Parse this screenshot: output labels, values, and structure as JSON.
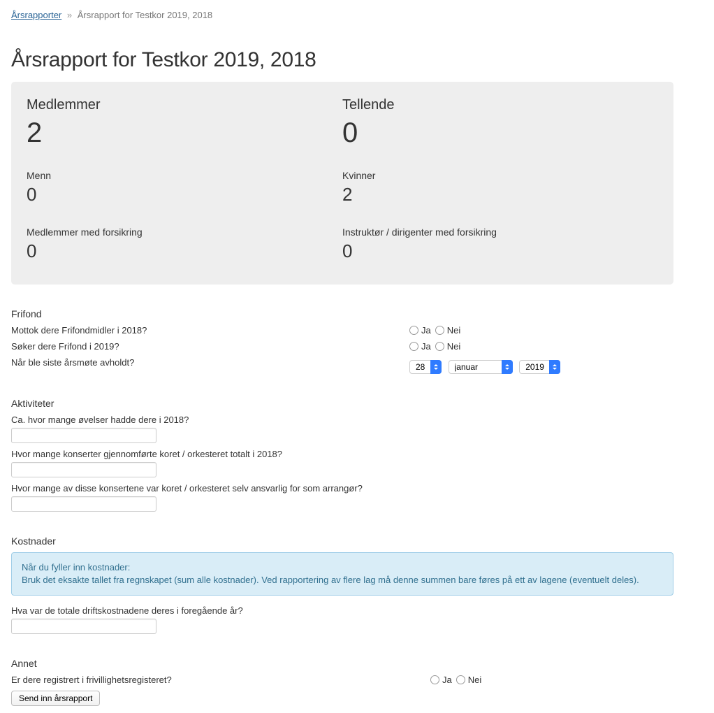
{
  "breadcrumb": {
    "root": "Årsrapporter",
    "sep": "»",
    "current": "Årsrapport for Testkor 2019, 2018"
  },
  "title": "Årsrapport for Testkor 2019, 2018",
  "stats": {
    "members_label": "Medlemmer",
    "members_value": "2",
    "counting_label": "Tellende",
    "counting_value": "0",
    "men_label": "Menn",
    "men_value": "0",
    "women_label": "Kvinner",
    "women_value": "2",
    "insured_members_label": "Medlemmer med forsikring",
    "insured_members_value": "0",
    "insured_instructors_label": "Instruktør / dirigenter med forsikring",
    "insured_instructors_value": "0"
  },
  "frifond": {
    "heading": "Frifond",
    "q_received": "Mottok dere Frifondmidler i 2018?",
    "q_apply": "Søker dere Frifond i 2019?",
    "q_meeting": "Når ble siste årsmøte avholdt?",
    "yes": "Ja",
    "no": "Nei",
    "day": "28",
    "month": "januar",
    "year": "2019"
  },
  "activities": {
    "heading": "Aktiviteter",
    "q_rehearsals": "Ca. hvor mange øvelser hadde dere i 2018?",
    "q_concerts_total": "Hvor mange konserter gjennomførte koret / orkesteret totalt i 2018?",
    "q_concerts_own": "Hvor mange av disse konsertene var koret / orkesteret selv ansvarlig for som arrangør?"
  },
  "costs": {
    "heading": "Kostnader",
    "info_line1": "Når du fyller inn kostnader:",
    "info_line2": "Bruk det eksakte tallet fra regnskapet (sum alle kostnader). Ved rapportering av flere lag må denne summen bare føres på ett av lagene (eventuelt deles).",
    "q_total": "Hva var de totale driftskostnadene deres i foregående år?"
  },
  "other": {
    "heading": "Annet",
    "q_register": "Er dere registrert i frivillighetsregisteret?",
    "yes": "Ja",
    "no": "Nei"
  },
  "submit_label": "Send inn årsrapport"
}
